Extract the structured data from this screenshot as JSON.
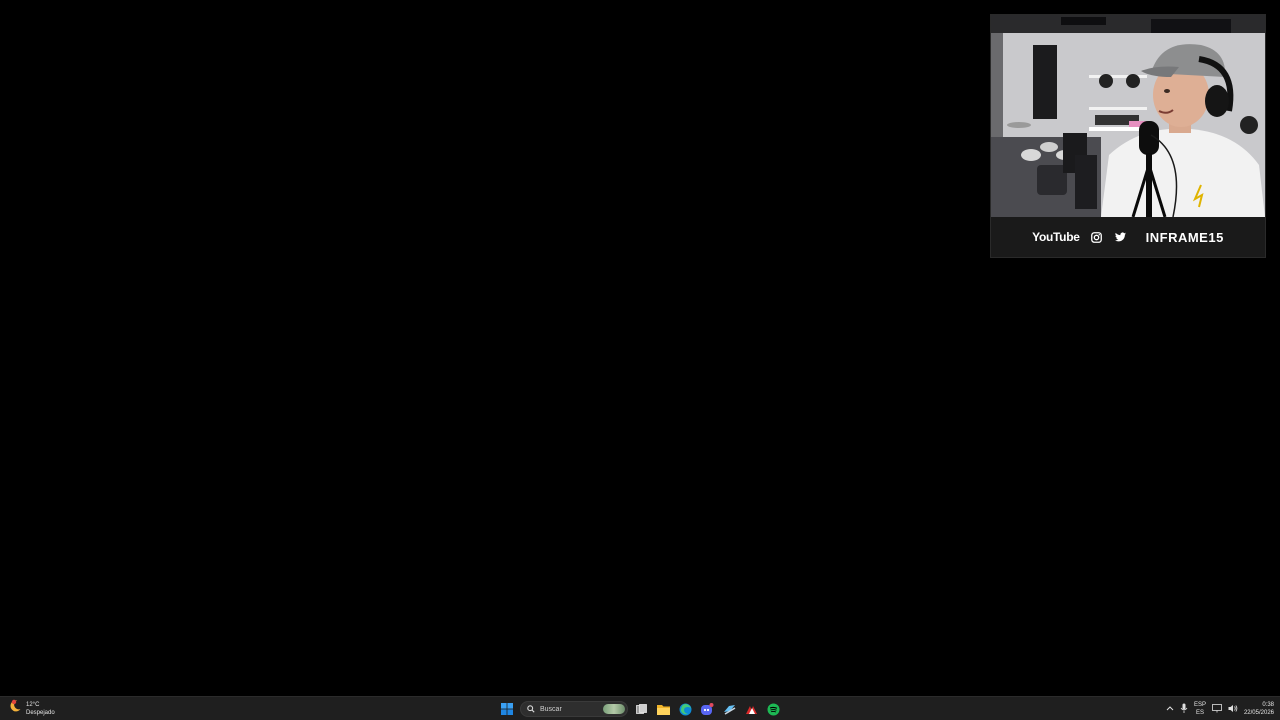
{
  "webcam": {
    "youtube_label": "YouTube",
    "instagram_icon": "instagram-icon",
    "twitter_icon": "twitter-icon",
    "handle": "INFRAME15"
  },
  "taskbar": {
    "weather": {
      "temp": "12°C",
      "condition": "Despejado",
      "icon": "weather-moon-icon"
    },
    "search_placeholder": "Buscar",
    "apps": [
      "windows-start-icon",
      "search-icon",
      "task-view-icon",
      "file-explorer-icon",
      "edge-icon",
      "discord-icon",
      "steam-icon",
      "app-icon",
      "spotify-icon"
    ],
    "tray": {
      "lang_top": "ESP",
      "lang_bottom": "ES",
      "time": "0:38",
      "date": "22/05/2026"
    }
  },
  "colors": {
    "taskbar_bg": "#1f1f1f",
    "spotify": "#1db954",
    "windows": "#0078d4",
    "edge": "#0c8ad8",
    "discord": "#5865f2"
  }
}
